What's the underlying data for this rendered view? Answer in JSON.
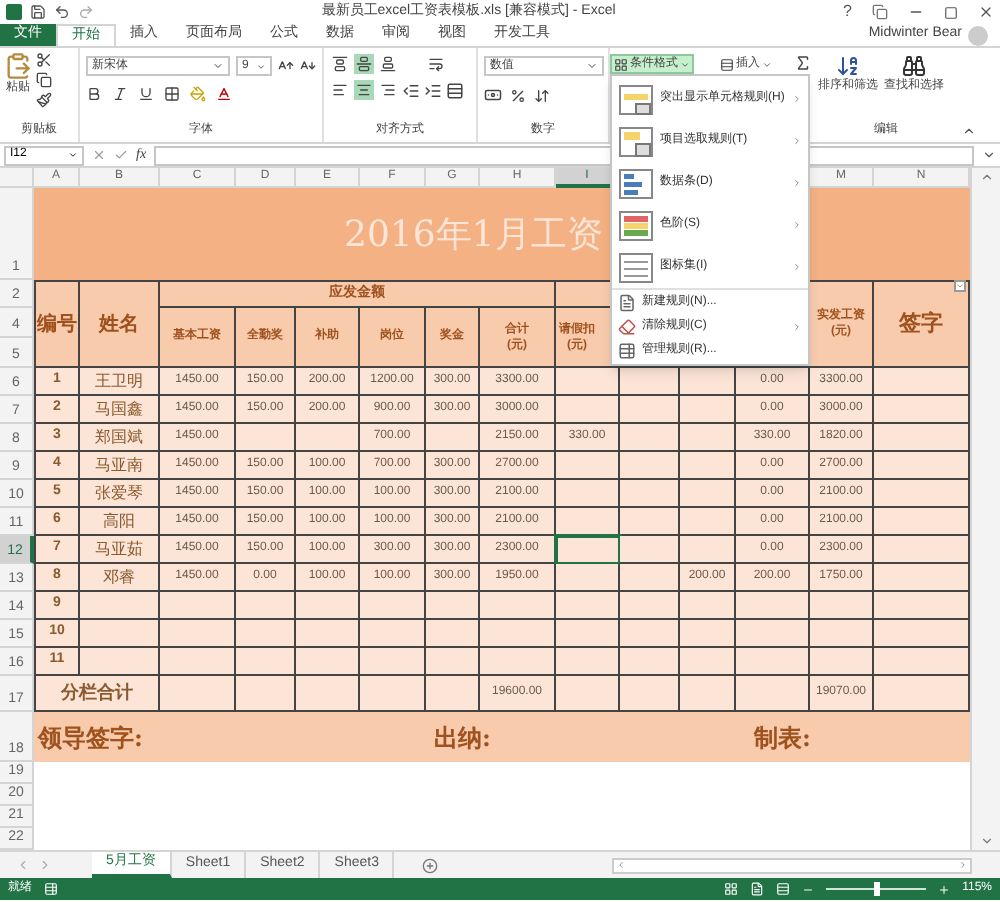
{
  "window": {
    "title": "最新员工excel工资表模板.xls  [兼容模式] - Excel",
    "help": "?"
  },
  "ribbon_tabs": [
    {
      "label": "文件",
      "kind": "file",
      "selected": false
    },
    {
      "label": "开始",
      "kind": "tab",
      "selected": true
    },
    {
      "label": "插入",
      "kind": "tab",
      "selected": false
    },
    {
      "label": "页面布局",
      "kind": "tab",
      "selected": false
    },
    {
      "label": "公式",
      "kind": "tab",
      "selected": false
    },
    {
      "label": "数据",
      "kind": "tab",
      "selected": false
    },
    {
      "label": "审阅",
      "kind": "tab",
      "selected": false
    },
    {
      "label": "视图",
      "kind": "tab",
      "selected": false
    },
    {
      "label": "开发工具",
      "kind": "tab",
      "selected": false
    }
  ],
  "user": {
    "name": "Midwinter Bear"
  },
  "ribbon": {
    "paste": "粘贴",
    "font_name": "新宋体",
    "font_size": "9",
    "number_format": "数值",
    "vertical_align": [
      {
        "kind": "top",
        "selected": false
      },
      {
        "kind": "middle",
        "selected": true
      },
      {
        "kind": "bottom",
        "selected": false
      }
    ],
    "horizontal_align": [
      {
        "kind": "left",
        "selected": false
      },
      {
        "kind": "center",
        "selected": true
      },
      {
        "kind": "right",
        "selected": false
      }
    ],
    "conditional_format": {
      "label": "条件格式",
      "expanded": true
    },
    "insert": "插入",
    "sort_filter": "排序和筛选",
    "find_select": "查找和选择",
    "group_labels": {
      "clipboard": "剪贴板",
      "font": "字体",
      "alignment": "对齐方式",
      "number": "数字",
      "editing": "编辑"
    }
  },
  "menu": {
    "items": [
      {
        "label": "突出显示单元格规则(H)",
        "kind": "large",
        "submenu": true
      },
      {
        "label": "项目选取规则(T)",
        "kind": "large",
        "submenu": true
      },
      {
        "label": "数据条(D)",
        "kind": "large",
        "submenu": true
      },
      {
        "label": "色阶(S)",
        "kind": "large",
        "submenu": true
      },
      {
        "label": "图标集(I)",
        "kind": "large",
        "submenu": true
      },
      {
        "label": "新建规则(N)...",
        "kind": "small",
        "submenu": false
      },
      {
        "label": "清除规则(C)",
        "kind": "small",
        "submenu": true
      },
      {
        "label": "管理规则(R)...",
        "kind": "small",
        "submenu": false
      }
    ]
  },
  "formula_bar": {
    "name_box": "I12",
    "function_label": "fx"
  },
  "sheet": {
    "columns": [
      {
        "label": "A",
        "selected": false
      },
      {
        "label": "B",
        "selected": false
      },
      {
        "label": "C",
        "selected": false
      },
      {
        "label": "D",
        "selected": false
      },
      {
        "label": "E",
        "selected": false
      },
      {
        "label": "F",
        "selected": false
      },
      {
        "label": "G",
        "selected": false
      },
      {
        "label": "H",
        "selected": false
      },
      {
        "label": "I",
        "selected": true
      }
    ],
    "columns_right": [
      {
        "label": "M",
        "selected": false
      },
      {
        "label": "N",
        "selected": false
      }
    ],
    "title_row": "1",
    "title": "2016年1月工资",
    "header": {
      "rows": [
        "2",
        "4",
        "5"
      ],
      "number": "编号",
      "name": "姓名",
      "group": "应发金额",
      "fields": [
        "基本工资",
        "全勤奖",
        "补助",
        "岗位",
        "奖金",
        "合计(元)"
      ],
      "deduction": "请假扣(元)",
      "net_pay": "实发工资(元)",
      "signature": "签字"
    },
    "rows": [
      {
        "row": "6",
        "no": "1",
        "name": "王卫明",
        "selected": false,
        "cells": {
          "C": "1450.00",
          "D": "150.00",
          "E": "200.00",
          "F": "1200.00",
          "G": "300.00",
          "H": "3300.00",
          "L": "0.00",
          "M": "3300.00"
        }
      },
      {
        "row": "7",
        "no": "2",
        "name": "马国鑫",
        "selected": false,
        "cells": {
          "C": "1450.00",
          "D": "150.00",
          "E": "200.00",
          "F": "900.00",
          "G": "300.00",
          "H": "3000.00",
          "L": "0.00",
          "M": "3000.00"
        }
      },
      {
        "row": "8",
        "no": "3",
        "name": "郑国斌",
        "selected": false,
        "cells": {
          "C": "1450.00",
          "F": "700.00",
          "H": "2150.00",
          "I": "330.00",
          "L": "330.00",
          "M": "1820.00"
        }
      },
      {
        "row": "9",
        "no": "4",
        "name": "马亚南",
        "selected": false,
        "cells": {
          "C": "1450.00",
          "D": "150.00",
          "E": "100.00",
          "F": "700.00",
          "G": "300.00",
          "H": "2700.00",
          "L": "0.00",
          "M": "2700.00"
        }
      },
      {
        "row": "10",
        "no": "5",
        "name": "张爱琴",
        "selected": false,
        "cells": {
          "C": "1450.00",
          "D": "150.00",
          "E": "100.00",
          "F": "100.00",
          "G": "300.00",
          "H": "2100.00",
          "L": "0.00",
          "M": "2100.00"
        }
      },
      {
        "row": "11",
        "no": "6",
        "name": "高阳",
        "selected": false,
        "cells": {
          "C": "1450.00",
          "D": "150.00",
          "E": "100.00",
          "F": "100.00",
          "G": "300.00",
          "H": "2100.00",
          "L": "0.00",
          "M": "2100.00"
        }
      },
      {
        "row": "12",
        "no": "7",
        "name": "马亚茹",
        "selected": true,
        "cells": {
          "C": "1450.00",
          "D": "150.00",
          "E": "100.00",
          "F": "300.00",
          "G": "300.00",
          "H": "2300.00",
          "L": "0.00",
          "M": "2300.00"
        }
      },
      {
        "row": "13",
        "no": "8",
        "name": "邓睿",
        "selected": false,
        "cells": {
          "C": "1450.00",
          "D": "0.00",
          "E": "100.00",
          "F": "100.00",
          "G": "300.00",
          "H": "1950.00",
          "K": "200.00",
          "L": "200.00",
          "M": "1750.00"
        }
      },
      {
        "row": "14",
        "no": "9",
        "selected": false,
        "cells": {}
      },
      {
        "row": "15",
        "no": "10",
        "selected": false,
        "cells": {}
      },
      {
        "row": "16",
        "no": "11",
        "selected": false,
        "cells": {}
      }
    ],
    "totals": {
      "row": "17",
      "label": "分栏合计",
      "cells": {
        "H": "19600.00",
        "M": "19070.00"
      }
    },
    "signatures": {
      "row": "18",
      "items": [
        "领导签字:",
        "出纳:",
        "制表:"
      ]
    },
    "empty_rows": [
      "19",
      "20",
      "21",
      "22"
    ]
  },
  "sheet_tabs": [
    {
      "label": "5月工资",
      "selected": true
    },
    {
      "label": "Sheet1",
      "selected": false
    },
    {
      "label": "Sheet2",
      "selected": false
    },
    {
      "label": "Sheet3",
      "selected": false
    }
  ],
  "status_bar": {
    "text": "就绪",
    "zoom": {
      "level": 0.5,
      "reading": "115%"
    }
  }
}
